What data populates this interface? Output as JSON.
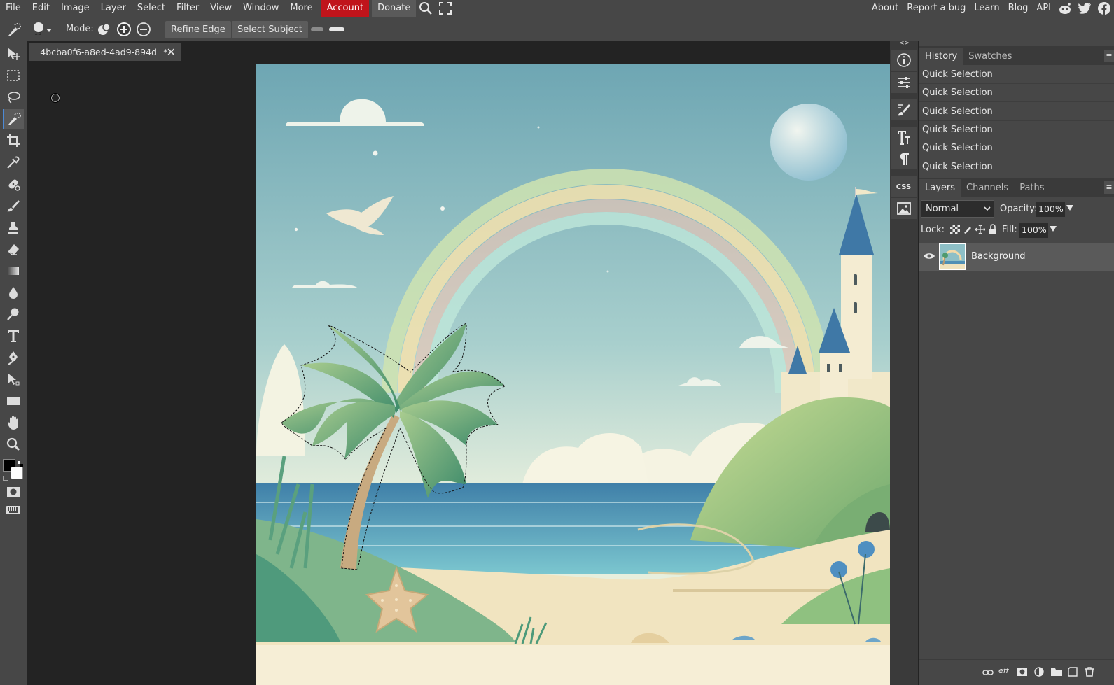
{
  "menu": {
    "items": [
      "File",
      "Edit",
      "Image",
      "Layer",
      "Select",
      "Filter",
      "View",
      "Window",
      "More"
    ],
    "account": "Account",
    "donate": "Donate",
    "right": [
      "About",
      "Report a bug",
      "Learn",
      "Blog",
      "API"
    ]
  },
  "options": {
    "brush_size": "15",
    "mode_label": "Mode:",
    "refine_edge": "Refine Edge",
    "select_subject": "Select Subject"
  },
  "document": {
    "tab_title": "_4bcba0f6-a8ed-4ad9-894d",
    "modified": "*"
  },
  "panels": {
    "collapse_left": "<>",
    "collapse_right": "><",
    "history_tabs": [
      "History",
      "Swatches"
    ],
    "history_items": [
      "Quick Selection",
      "Quick Selection",
      "Quick Selection",
      "Quick Selection",
      "Quick Selection",
      "Quick Selection"
    ],
    "layer_tabs": [
      "Layers",
      "Channels",
      "Paths"
    ],
    "blend_mode": "Normal",
    "opacity_label": "Opacity:",
    "opacity": "100%",
    "lock_label": "Lock:",
    "fill_label": "Fill:",
    "fill": "100%",
    "layer_name": "Background",
    "css_label": "CSS"
  },
  "colors": {
    "accent": "#4c8ad6",
    "account_bg": "#c0141b",
    "foreground_swatch": "#000000",
    "background_swatch": "#ffffff"
  }
}
